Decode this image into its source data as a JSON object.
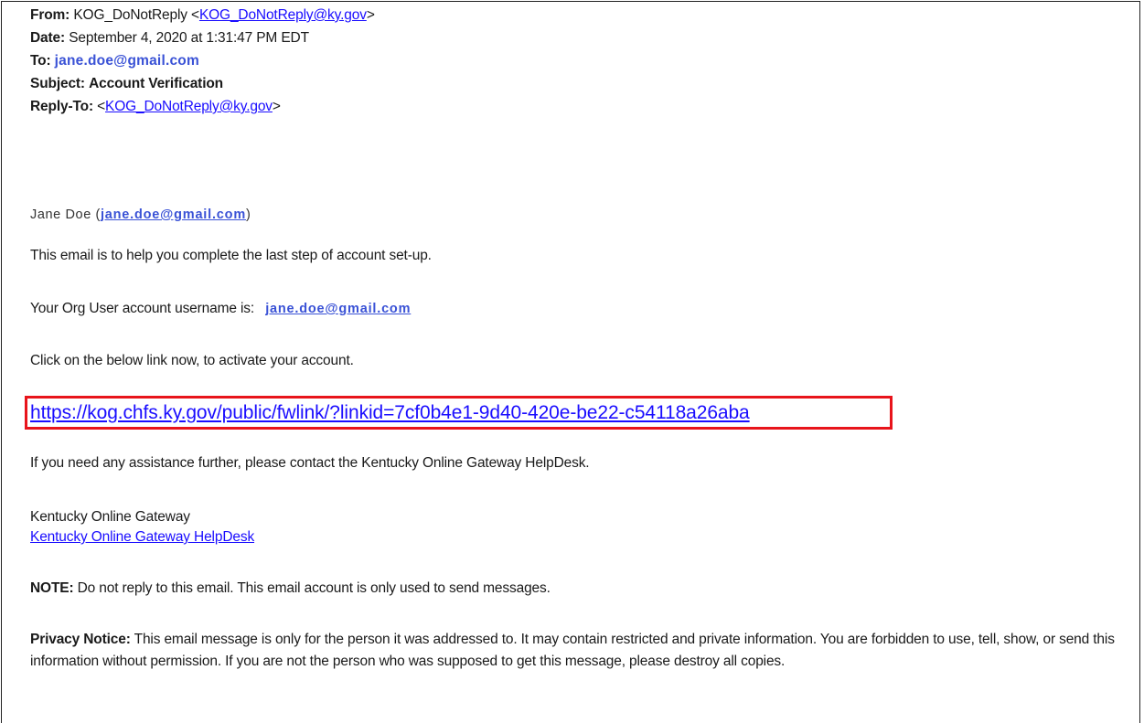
{
  "header": {
    "from_label": "From:",
    "from_name": "KOG_DoNotReply <",
    "from_email": "KOG_DoNotReply@ky.gov",
    "from_close": ">",
    "date_label": "Date:",
    "date_value": "September 4, 2020 at 1:31:47 PM EDT",
    "to_label": "To:",
    "to_value": "jane.doe@gmail.com",
    "subject_label": "Subject:",
    "subject_value": "Account Verification",
    "replyto_label": "Reply-To:",
    "replyto_open": "<",
    "replyto_email": "KOG_DoNotReply@ky.gov",
    "replyto_close": ">"
  },
  "body": {
    "greeting_name": "Jane Doe (",
    "greeting_email": "jane.doe@gmail.com",
    "greeting_close": ")",
    "intro": "This email is to help you complete the last step of account set-up.",
    "username_prefix": "Your Org User account username is:",
    "username_value": "jane.doe@gmail.com",
    "click_instruction": "Click on the below link now, to activate your account.",
    "activation_link": "https://kog.chfs.ky.gov/public/fwlink/?linkid=7cf0b4e1-9d40-420e-be22-c54118a26aba",
    "assistance": "If you need any assistance further, please contact the Kentucky Online Gateway HelpDesk.",
    "signature_name": "Kentucky Online Gateway",
    "signature_link": "Kentucky Online Gateway HelpDesk",
    "note_label": "NOTE:",
    "note_text": " Do not reply to this email. This email account is only used to send messages.",
    "privacy_label": "Privacy Notice:",
    "privacy_text": " This email message is only for the person it was addressed to. It may contain restricted and private information. You are forbidden to use, tell, show, or send this information without permission. If you are not the person who was supposed to get this message, please destroy all copies."
  },
  "colors": {
    "link": "#1a0dff",
    "email_highlight": "#3a52d6",
    "highlight_box": "#e8141b"
  }
}
